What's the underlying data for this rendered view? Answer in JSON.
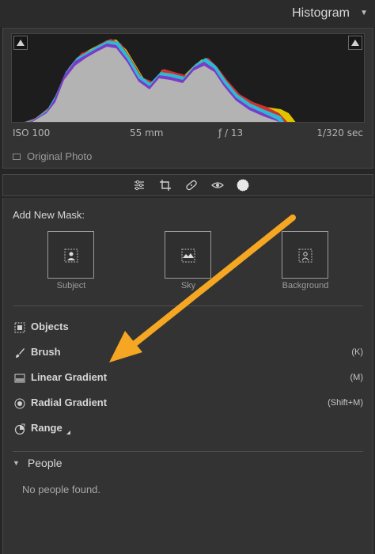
{
  "header": {
    "title": "Histogram",
    "caret": "▼"
  },
  "histogram": {
    "exif": {
      "iso": "ISO 100",
      "focal": "55 mm",
      "aperture": "ƒ / 13",
      "shutter": "1/320 sec"
    },
    "original_photo_label": "Original Photo"
  },
  "tools": [
    {
      "name": "edit-sliders-icon"
    },
    {
      "name": "crop-icon"
    },
    {
      "name": "healing-icon"
    },
    {
      "name": "red-eye-icon"
    },
    {
      "name": "masking-icon"
    }
  ],
  "mask": {
    "heading": "Add New Mask:",
    "tiles": [
      {
        "label": "Subject"
      },
      {
        "label": "Sky"
      },
      {
        "label": "Background"
      }
    ],
    "tools": [
      {
        "label": "Objects",
        "key": "",
        "icon": "objects-icon"
      },
      {
        "label": "Brush",
        "key": "(K)",
        "icon": "brush-icon"
      },
      {
        "label": "Linear Gradient",
        "key": "(M)",
        "icon": "linear-gradient-icon"
      },
      {
        "label": "Radial Gradient",
        "key": "(Shift+M)",
        "icon": "radial-gradient-icon"
      },
      {
        "label": "Range",
        "key": "",
        "icon": "range-icon"
      }
    ]
  },
  "people": {
    "heading": "People",
    "empty_text": "No people found."
  },
  "colors": {
    "annotation_arrow": "#f5a623"
  }
}
